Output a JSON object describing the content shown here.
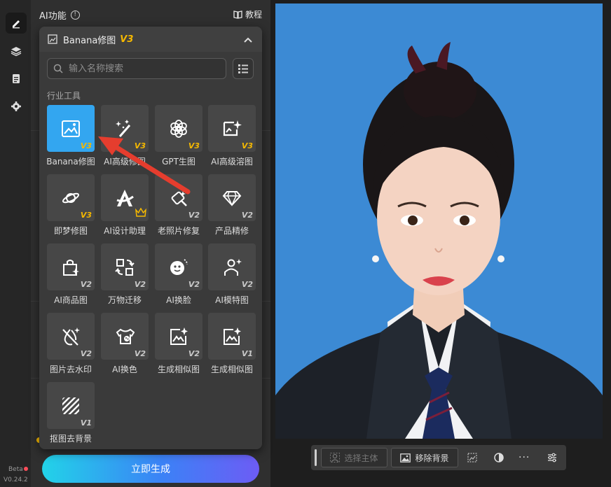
{
  "panel": {
    "title": "AI功能",
    "info_icon_text": "!",
    "tutorial_label": "教程"
  },
  "rail": {
    "beta": "Beta",
    "version": "V0.24.2"
  },
  "dropdown": {
    "title": "Banana修图",
    "badge": "V3",
    "search_placeholder": "输入名称搜索",
    "section_label": "行业工具",
    "tools": [
      {
        "label": "Banana修图",
        "badge": "V3",
        "icon": "image-edit-icon"
      },
      {
        "label": "AI高级修图",
        "badge": "V3",
        "icon": "magic-wand-icon"
      },
      {
        "label": "GPT生图",
        "badge": "V3",
        "icon": "openai-knot-icon"
      },
      {
        "label": "AI高级溶图",
        "badge": "V3",
        "icon": "sparkle-image-icon"
      },
      {
        "label": "即梦修图",
        "badge": "V3",
        "icon": "planet-icon"
      },
      {
        "label": "AI设计助理",
        "badge": "crown",
        "icon": "design-a-icon"
      },
      {
        "label": "老照片修复",
        "badge": "V2",
        "icon": "photo-repair-icon"
      },
      {
        "label": "产品精修",
        "badge": "V2",
        "icon": "diamond-icon"
      },
      {
        "label": "AI商品图",
        "badge": "V2",
        "icon": "shopping-bag-icon"
      },
      {
        "label": "万物迁移",
        "badge": "V2",
        "icon": "transfer-icon"
      },
      {
        "label": "AI换脸",
        "badge": "V2",
        "icon": "face-swap-icon"
      },
      {
        "label": "AI模特图",
        "badge": "V2",
        "icon": "model-person-icon"
      },
      {
        "label": "图片去水印",
        "badge": "V2",
        "icon": "watermark-remove-icon"
      },
      {
        "label": "AI换色",
        "badge": "V2",
        "icon": "shirt-palette-icon"
      },
      {
        "label": "生成相似图",
        "badge": "V2",
        "icon": "image-sparkle-icon"
      },
      {
        "label": "生成相似图",
        "badge": "V1",
        "icon": "image-sparkle-icon"
      },
      {
        "label": "抠图去背景",
        "badge": "V1",
        "icon": "cutout-stripes-icon"
      }
    ]
  },
  "generate_button": "立即生成",
  "toolbar": {
    "select_subject": "选择主体",
    "remove_background": "移除背景",
    "more": "..."
  },
  "colors": {
    "accent_blue": "#33a6f0",
    "badge_gold": "#f5b800",
    "photo_bg": "#3c8ad4",
    "arrow_red": "#e53d2e"
  }
}
